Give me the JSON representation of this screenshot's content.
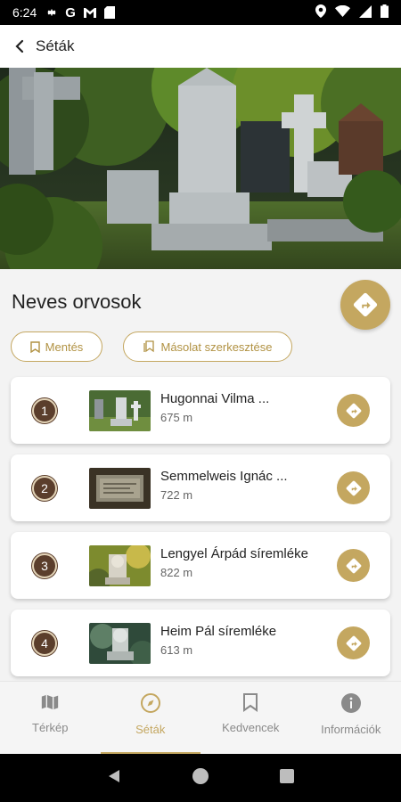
{
  "status_bar": {
    "time": "6:24"
  },
  "app_bar": {
    "title": "Séták"
  },
  "walk": {
    "title": "Neves orvosok",
    "save_label": "Mentés",
    "copy_label": "Másolat szerkesztése"
  },
  "stops": [
    {
      "number": "1",
      "name": "Hugonnai Vilma ...",
      "distance": "675 m"
    },
    {
      "number": "2",
      "name": "Semmelweis Ignác ...",
      "distance": "722 m"
    },
    {
      "number": "3",
      "name": "Lengyel Árpád síremléke",
      "distance": "822 m"
    },
    {
      "number": "4",
      "name": "Heim Pál síremléke",
      "distance": "613 m"
    }
  ],
  "bottom_nav": [
    {
      "label": "Térkép",
      "icon": "map-icon",
      "active": false
    },
    {
      "label": "Séták",
      "icon": "compass-icon",
      "active": true
    },
    {
      "label": "Kedvencek",
      "icon": "bookmark-icon",
      "active": false
    },
    {
      "label": "Információk",
      "icon": "info-icon",
      "active": false
    }
  ],
  "colors": {
    "accent": "#c4a760",
    "badge": "#5b3e2c",
    "background": "#f3f3f3"
  }
}
